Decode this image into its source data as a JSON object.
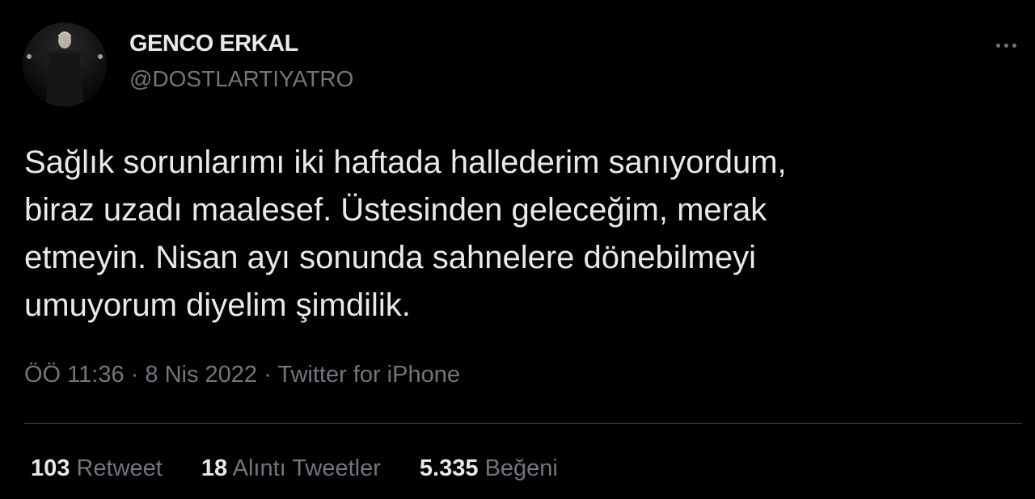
{
  "author": {
    "display_name": "GENCO ERKAL",
    "handle": "@DOSTLARTIYATRO",
    "avatar_icon": "profile-photo"
  },
  "tweet": {
    "lines": [
      "Sağlık sorunlarımı iki haftada hallederim sanıyordum,",
      "biraz uzadı maalesef. Üstesinden geleceğim, merak",
      "etmeyin. Nisan ayı sonunda sahnelere dönebilmeyi",
      "umuyorum diyelim şimdilik."
    ]
  },
  "meta": {
    "time": "ÖÖ 11:36",
    "separator": "·",
    "date": "8 Nis 2022",
    "source": "Twitter for iPhone"
  },
  "stats": {
    "retweets": {
      "count": "103",
      "label": "Retweet"
    },
    "quotes": {
      "count": "18",
      "label": "Alıntı Tweetler"
    },
    "likes": {
      "count": "5.335",
      "label": "Beğeni"
    }
  },
  "menu_icon": "more-horizontal-icon",
  "colors": {
    "background": "#000000",
    "text": "#e7e9ea",
    "secondary": "#71767b",
    "divider": "#2f3336"
  }
}
